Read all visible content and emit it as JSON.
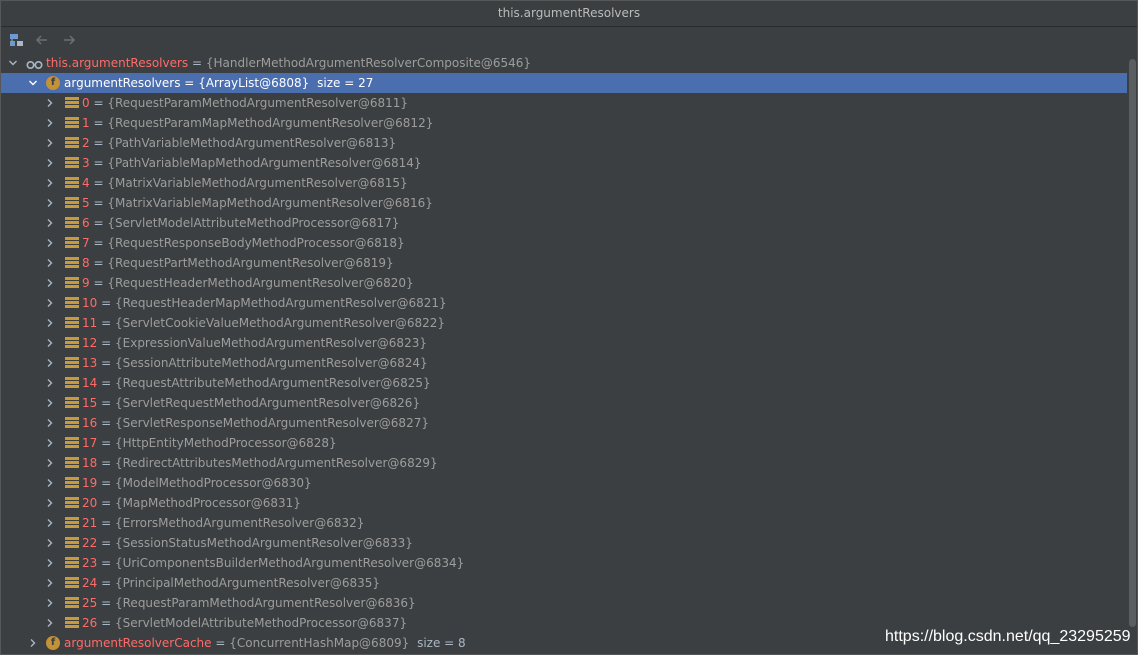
{
  "window": {
    "title": "this.argumentResolvers"
  },
  "toolbar": {
    "items": [
      {
        "icon": "object-view-icon"
      },
      {
        "icon": "back-arrow-icon"
      },
      {
        "icon": "forward-arrow-icon"
      }
    ]
  },
  "tree": {
    "root": {
      "name": "this.argumentResolvers",
      "eq": "=",
      "value": "{HandlerMethodArgumentResolverComposite@6546}",
      "icon": "watch-glasses-icon",
      "expanded": true
    },
    "field": {
      "name": "argumentResolvers",
      "eq": "=",
      "value": "{ArrayList@6808}",
      "size": "size = 27",
      "icon": "field-icon",
      "icon_letter": "f",
      "expanded": true,
      "selected": true
    },
    "items": [
      {
        "index": "0",
        "value": "{RequestParamMethodArgumentResolver@6811}"
      },
      {
        "index": "1",
        "value": "{RequestParamMapMethodArgumentResolver@6812}"
      },
      {
        "index": "2",
        "value": "{PathVariableMethodArgumentResolver@6813}"
      },
      {
        "index": "3",
        "value": "{PathVariableMapMethodArgumentResolver@6814}"
      },
      {
        "index": "4",
        "value": "{MatrixVariableMethodArgumentResolver@6815}"
      },
      {
        "index": "5",
        "value": "{MatrixVariableMapMethodArgumentResolver@6816}"
      },
      {
        "index": "6",
        "value": "{ServletModelAttributeMethodProcessor@6817}"
      },
      {
        "index": "7",
        "value": "{RequestResponseBodyMethodProcessor@6818}"
      },
      {
        "index": "8",
        "value": "{RequestPartMethodArgumentResolver@6819}"
      },
      {
        "index": "9",
        "value": "{RequestHeaderMethodArgumentResolver@6820}"
      },
      {
        "index": "10",
        "value": "{RequestHeaderMapMethodArgumentResolver@6821}"
      },
      {
        "index": "11",
        "value": "{ServletCookieValueMethodArgumentResolver@6822}"
      },
      {
        "index": "12",
        "value": "{ExpressionValueMethodArgumentResolver@6823}"
      },
      {
        "index": "13",
        "value": "{SessionAttributeMethodArgumentResolver@6824}"
      },
      {
        "index": "14",
        "value": "{RequestAttributeMethodArgumentResolver@6825}"
      },
      {
        "index": "15",
        "value": "{ServletRequestMethodArgumentResolver@6826}"
      },
      {
        "index": "16",
        "value": "{ServletResponseMethodArgumentResolver@6827}"
      },
      {
        "index": "17",
        "value": "{HttpEntityMethodProcessor@6828}"
      },
      {
        "index": "18",
        "value": "{RedirectAttributesMethodArgumentResolver@6829}"
      },
      {
        "index": "19",
        "value": "{ModelMethodProcessor@6830}"
      },
      {
        "index": "20",
        "value": "{MapMethodProcessor@6831}"
      },
      {
        "index": "21",
        "value": "{ErrorsMethodArgumentResolver@6832}"
      },
      {
        "index": "22",
        "value": "{SessionStatusMethodArgumentResolver@6833}"
      },
      {
        "index": "23",
        "value": "{UriComponentsBuilderMethodArgumentResolver@6834}"
      },
      {
        "index": "24",
        "value": "{PrincipalMethodArgumentResolver@6835}"
      },
      {
        "index": "25",
        "value": "{RequestParamMethodArgumentResolver@6836}"
      },
      {
        "index": "26",
        "value": "{ServletModelAttributeMethodProcessor@6837}"
      }
    ],
    "item_icon": "array-element-icon",
    "cache_field": {
      "name": "argumentResolverCache",
      "eq": "=",
      "value": "{ConcurrentHashMap@6809}",
      "size": "size = 8",
      "icon": "field-icon",
      "icon_letter": "f",
      "expanded": false
    }
  },
  "watermark": {
    "text": "https://blog.csdn.net/qq_23295259"
  },
  "colors": {
    "background": "#3c3f41",
    "selection": "#4b6eaf",
    "name": "#ff6b68",
    "value": "#9d9d9d",
    "field_icon": "#c39137"
  }
}
